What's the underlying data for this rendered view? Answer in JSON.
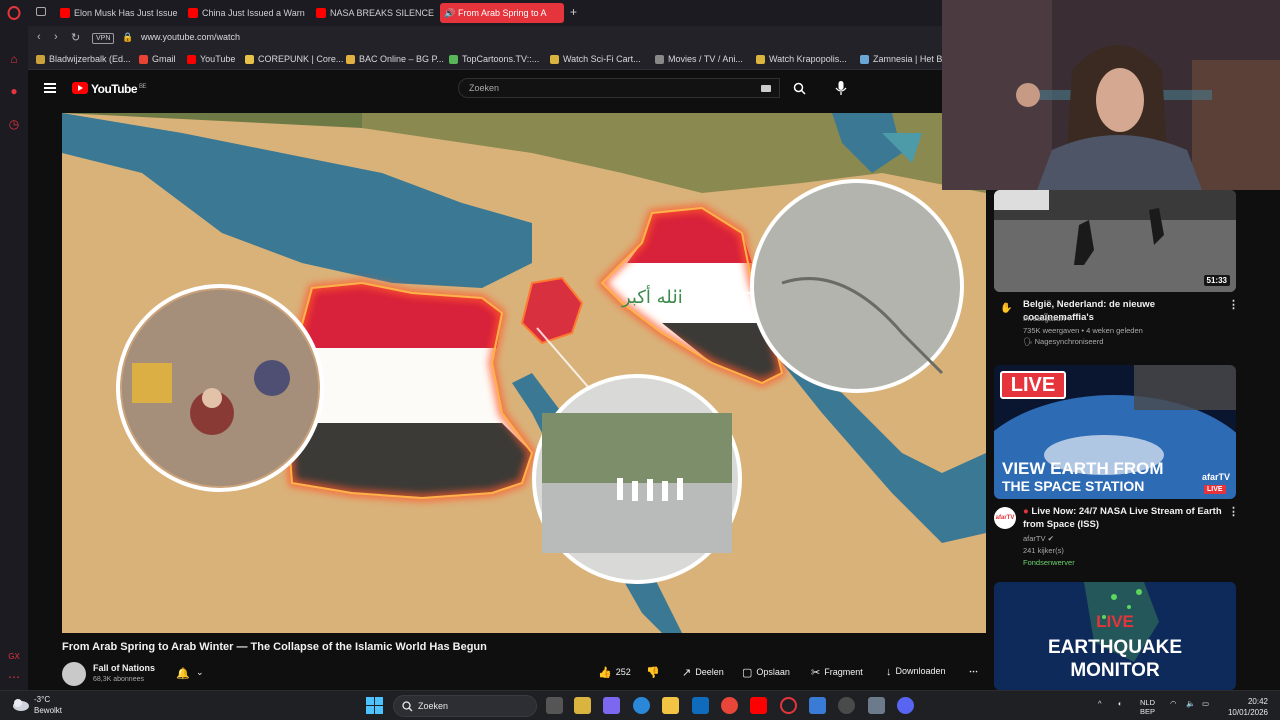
{
  "tabs": [
    {
      "label": "Elon Musk Has Just Issue"
    },
    {
      "label": "China Just Issued a Warn"
    },
    {
      "label": "NASA BREAKS SILENCE o"
    },
    {
      "label": "From Arab Spring to A"
    }
  ],
  "address": {
    "vpn": "VPN",
    "url": "www.youtube.com/watch"
  },
  "bookmarks": [
    {
      "label": "Bladwijzerbalk (Ed..."
    },
    {
      "label": "Gmail"
    },
    {
      "label": "YouTube"
    },
    {
      "label": "COREPUNK | Core..."
    },
    {
      "label": "BAC Online – BG P..."
    },
    {
      "label": "TopCartoons.TV::..."
    },
    {
      "label": "Watch Sci-Fi Cart..."
    },
    {
      "label": "Movies / TV / Ani..."
    },
    {
      "label": "Watch Krapopolis..."
    },
    {
      "label": "Zamnesia | Het Be"
    }
  ],
  "youtube": {
    "logo": "YouTube",
    "region": "BE",
    "search_placeholder": "Zoeken",
    "brand_color": "#ff0000"
  },
  "video": {
    "title": "From Arab Spring to Arab Winter — The Collapse of the Islamic World Has Begun",
    "channel": "Fall of Nations",
    "subscribers": "68,3K abonnees",
    "likes": "252",
    "actions": {
      "share": "Deelen",
      "save": "Opslaan",
      "clip": "Fragment",
      "download": "Downloaden"
    }
  },
  "sidebar": [
    {
      "title": "België, Nederland: de nieuwe cocaïnemaffia's",
      "channel": "Investigation",
      "meta": "735K weergaven • 4 weken geleden",
      "extra": "Nagesynchroniseerd",
      "duration": "51:33"
    },
    {
      "title": "Live Now: 24/7 NASA Live Stream of Earth from Space (ISS)",
      "channel": "afarTV",
      "meta": "241 kijker(s)",
      "extra": "Fondsenwerver",
      "live_badge": "LIVE",
      "thumb_line1": "VIEW EARTH FROM",
      "thumb_line2": "THE SPACE STATION",
      "thumb_brand": "afarTV",
      "thumb_live": "LIVE"
    },
    {
      "thumb_live": "LIVE",
      "thumb_line1": "EARTHQUAKE",
      "thumb_line2": "MONITOR"
    }
  ],
  "taskbar": {
    "temp": "-3°C",
    "weather": "Bewolkt",
    "search": "Zoeken",
    "lang1": "NLD",
    "lang2": "BEP",
    "time": "20:42",
    "date": "10/01/2026"
  }
}
